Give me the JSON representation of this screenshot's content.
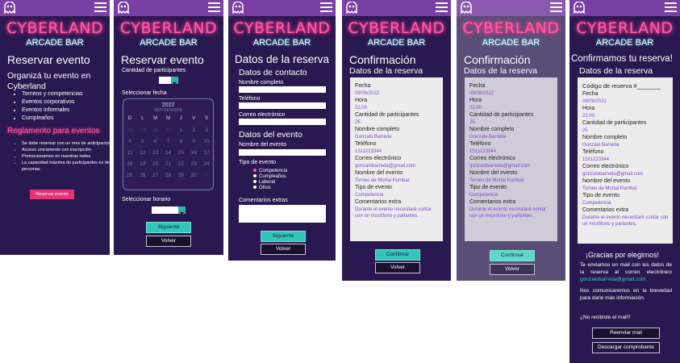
{
  "brand": {
    "line1": "CYBERLAND",
    "line2": "ARCADE BAR"
  },
  "screen1": {
    "title": "Reservar evento",
    "intro": "Organizá tu evento en Cyberland",
    "types": [
      "Torneos y competencias",
      "Eventos corporativos",
      "Eventos informales",
      "Cumpleaños"
    ],
    "rules_title": "Reglamento para eventos",
    "rules": [
      "Se debe reservar con un mes de anticipación",
      "Acceso unicamente con inscripción",
      "Promocionamos en nuestras redes",
      "La capacidad máxima de participantes es de 50 personas"
    ],
    "button": "Reservar evento"
  },
  "screen2": {
    "title": "Reservar evento",
    "participants_label": "Cantidad de participantes",
    "date_label": "Seleccionar fecha",
    "calendar": {
      "year": "2022",
      "month": "SEPTIEMBRE",
      "weekdays": [
        "D",
        "L",
        "M",
        "M",
        "J",
        "V",
        "S"
      ],
      "weeks": [
        [
          "28",
          "29",
          "30",
          "31",
          "1",
          "2",
          "3"
        ],
        [
          "4",
          "5",
          "6",
          "7",
          "8",
          "9",
          "10"
        ],
        [
          "11",
          "12",
          "13",
          "14",
          "15",
          "16",
          "17"
        ],
        [
          "18",
          "19",
          "20",
          "21",
          "22",
          "23",
          "24"
        ],
        [
          "25",
          "26",
          "27",
          "28",
          "29",
          "30",
          "1"
        ]
      ]
    },
    "time_label": "Seleccionar horario",
    "next": "Siguiente",
    "back": "Volver"
  },
  "screen3": {
    "title": "Datos de la reserva",
    "contact_title": "Datos de contacto",
    "name_label": "Nombre completo",
    "phone_label": "Teléfono",
    "email_label": "Correo electrónico",
    "event_title": "Datos del evento",
    "event_name_label": "Nombre del evento",
    "event_type_label": "Tipo de evento",
    "event_types": [
      "Competencia",
      "Cumpleaños",
      "Laboral",
      "Otros"
    ],
    "comments_label": "Comentarios extras",
    "next": "Siguiente",
    "back": "Volver"
  },
  "summary": {
    "labels": {
      "date": "Fecha",
      "time": "Hora",
      "participants": "Cantidad de participantes",
      "name": "Nombre completo",
      "phone": "Teléfono",
      "email": "Correo electrónico",
      "event_name": "Nombre del evento",
      "event_type": "Tipo de evento",
      "comments": "Comentarios extra"
    },
    "values": {
      "date": "09/09/2022",
      "time": "22:00",
      "participants": "25",
      "name": "Gonzalo Barreda",
      "phone": "1511223344",
      "email": "gonzalobarreda@gmail.com",
      "event_name": "Torneo de Mortal Kombat",
      "event_type": "Competencia",
      "comments": "Durante el evento necesitaré contar con un micrófono y parlantes."
    }
  },
  "screen4": {
    "title": "Confirmación",
    "subtitle": "Datos de la reserva",
    "confirm": "Confirmar",
    "back": "Volver"
  },
  "screen6": {
    "title": "Confirmamos tu reserva!",
    "subtitle": "Datos de la reserva",
    "code_label": "Código de reserva #_______",
    "thanks": "¡Gracias por elegirnos!",
    "sent_msg": "Te enviamos un mail con los datos de la reserva al correo electrónico",
    "email": "gonzalobarreda@gmail.com.",
    "contact_msg": "Nos comunicaremos en la brevedad para darle más información.",
    "not_received": "¿No recibiste el mail?",
    "resend": "Reenviar mail",
    "download": "Descargar comprobante"
  }
}
